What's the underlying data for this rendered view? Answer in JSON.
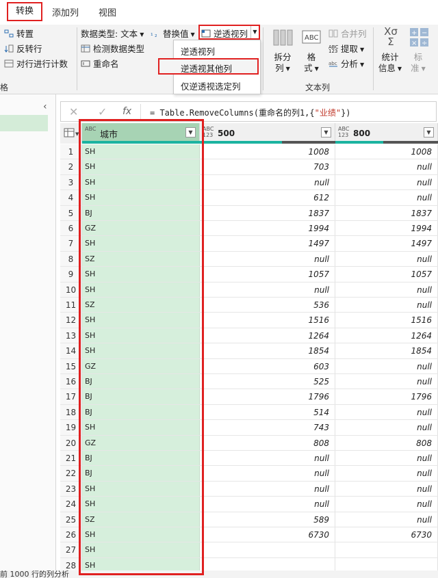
{
  "tabs": [
    {
      "label": "转换"
    },
    {
      "label": "添加列"
    },
    {
      "label": "视图"
    }
  ],
  "ribbon": {
    "left_col": [
      "转置",
      "反转行",
      "对行进行计数"
    ],
    "left_group": "格",
    "data_type": "数据类型: 文本",
    "replace_values": "替换值",
    "pivot_label": "逆透视列",
    "detect_type": "检测数据类型",
    "rename": "重命名",
    "split_col": [
      "拆分",
      "列"
    ],
    "format": [
      "格",
      "式"
    ],
    "merge_cols": "合并列",
    "extract": "提取",
    "parse": "分析",
    "text_group": "文本列",
    "stats": [
      "统计",
      "信息"
    ],
    "standard": [
      "标",
      "准"
    ]
  },
  "dropdown": {
    "items": [
      "逆透视列",
      "逆透视其他列",
      "仅逆透视选定列"
    ]
  },
  "formula": {
    "prefix": "= Table.RemoveColumns(重命名的列1,{",
    "string": "\"业绩\"",
    "suffix": "})"
  },
  "grid": {
    "headers": [
      {
        "type": "ABC",
        "label": "城市"
      },
      {
        "type": "ABC 123",
        "label": "500"
      },
      {
        "type": "ABC 123",
        "label": "800"
      }
    ],
    "rows": [
      {
        "n": "1",
        "city": "SH",
        "v500": "1008",
        "v800": "1008"
      },
      {
        "n": "2",
        "city": "SH",
        "v500": "703",
        "v800": "null"
      },
      {
        "n": "3",
        "city": "SH",
        "v500": "null",
        "v800": "null"
      },
      {
        "n": "4",
        "city": "SH",
        "v500": "612",
        "v800": "null"
      },
      {
        "n": "5",
        "city": "BJ",
        "v500": "1837",
        "v800": "1837"
      },
      {
        "n": "6",
        "city": "GZ",
        "v500": "1994",
        "v800": "1994"
      },
      {
        "n": "7",
        "city": "SH",
        "v500": "1497",
        "v800": "1497"
      },
      {
        "n": "8",
        "city": "SZ",
        "v500": "null",
        "v800": "null"
      },
      {
        "n": "9",
        "city": "SH",
        "v500": "1057",
        "v800": "1057"
      },
      {
        "n": "10",
        "city": "SH",
        "v500": "null",
        "v800": "null"
      },
      {
        "n": "11",
        "city": "SZ",
        "v500": "536",
        "v800": "null"
      },
      {
        "n": "12",
        "city": "SH",
        "v500": "1516",
        "v800": "1516"
      },
      {
        "n": "13",
        "city": "SH",
        "v500": "1264",
        "v800": "1264"
      },
      {
        "n": "14",
        "city": "SH",
        "v500": "1854",
        "v800": "1854"
      },
      {
        "n": "15",
        "city": "GZ",
        "v500": "603",
        "v800": "null"
      },
      {
        "n": "16",
        "city": "BJ",
        "v500": "525",
        "v800": "null"
      },
      {
        "n": "17",
        "city": "BJ",
        "v500": "1796",
        "v800": "1796"
      },
      {
        "n": "18",
        "city": "BJ",
        "v500": "514",
        "v800": "null"
      },
      {
        "n": "19",
        "city": "SH",
        "v500": "743",
        "v800": "null"
      },
      {
        "n": "20",
        "city": "GZ",
        "v500": "808",
        "v800": "808"
      },
      {
        "n": "21",
        "city": "BJ",
        "v500": "null",
        "v800": "null"
      },
      {
        "n": "22",
        "city": "BJ",
        "v500": "null",
        "v800": "null"
      },
      {
        "n": "23",
        "city": "SH",
        "v500": "null",
        "v800": "null"
      },
      {
        "n": "24",
        "city": "SH",
        "v500": "null",
        "v800": "null"
      },
      {
        "n": "25",
        "city": "SZ",
        "v500": "589",
        "v800": "null"
      },
      {
        "n": "26",
        "city": "SH",
        "v500": "6730",
        "v800": "6730"
      },
      {
        "n": "27",
        "city": "SH",
        "v500": "",
        "v800": ""
      },
      {
        "n": "28",
        "city": "SH",
        "v500": "",
        "v800": ""
      }
    ]
  },
  "status": "前 1000 行的列分析",
  "colors": {
    "accent_red": "#e02020",
    "selected_col": "#d6efdc",
    "selected_header": "#a7d3b4",
    "quality_bar": "#1bb3a0"
  }
}
